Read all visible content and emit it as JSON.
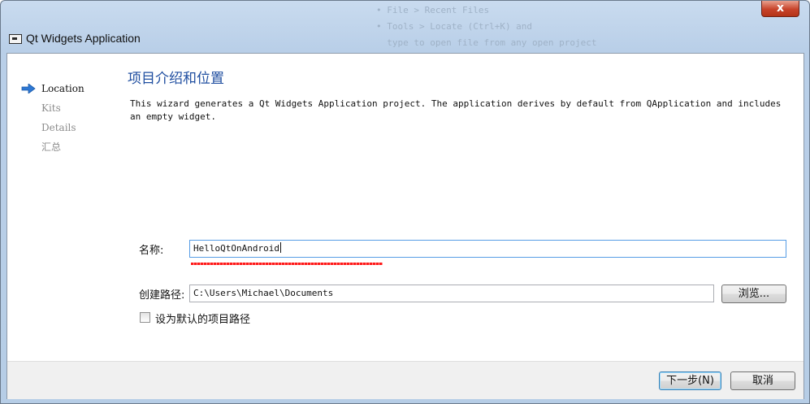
{
  "window": {
    "title": "Qt Widgets Application",
    "close_label": "x",
    "background_text": "• File > Recent Files\n• Tools > Locate (Ctrl+K) and\n  type to open file from any open project"
  },
  "nav": {
    "items": [
      {
        "label": "Location",
        "state": "active"
      },
      {
        "label": "Kits",
        "state": "inactive"
      },
      {
        "label": "Details",
        "state": "inactive"
      },
      {
        "label": "汇总",
        "state": "inactive"
      }
    ]
  },
  "page": {
    "title": "项目介绍和位置",
    "description": "This wizard generates a Qt Widgets Application project. The application derives by default from QApplication and includes an empty widget."
  },
  "form": {
    "name_label": "名称:",
    "name_value": "HelloQtOnAndroid",
    "path_label": "创建路径:",
    "path_value": "C:\\Users\\Michael\\Documents",
    "browse_label": "浏览...",
    "default_path_label": "设为默认的项目路径",
    "default_path_checked": false
  },
  "buttons": {
    "next_label": "下一步(N)",
    "cancel_label": "取消"
  },
  "colors": {
    "title_blue": "#1f4ea0",
    "nav_arrow": "#2e78d4",
    "spell_check_red": "#ff1a1a"
  }
}
